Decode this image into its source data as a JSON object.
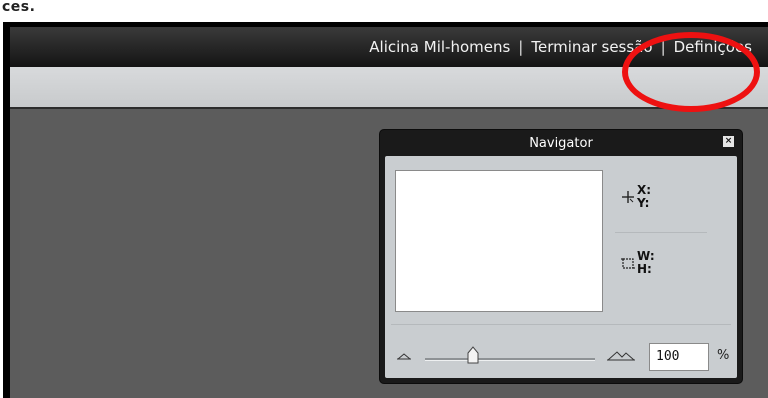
{
  "page": {
    "top_fragment_text": "ces."
  },
  "header": {
    "user_name": "Alicina Mil-homens",
    "separator_1": "|",
    "logout_label": "Terminar sessão",
    "separator_2": "|",
    "settings_label": "Definições"
  },
  "navigator": {
    "title": "Navigator",
    "close_glyph": "×",
    "x_label": "X:",
    "y_label": "Y:",
    "w_label": "W:",
    "h_label": "H:",
    "zoom_value": "100",
    "zoom_unit": "%",
    "zoom_slider_level": 0.28
  },
  "colors": {
    "highlight": "#ee1111",
    "topbar": "#1e1e1e",
    "canvas": "#5c5c5c",
    "panel_body": "#c9cdd0"
  },
  "icons": {
    "position": "crosshair-icon",
    "size": "crop-rect-icon",
    "zoom_out": "small-mountain-icon",
    "zoom_in": "large-mountain-icon"
  }
}
